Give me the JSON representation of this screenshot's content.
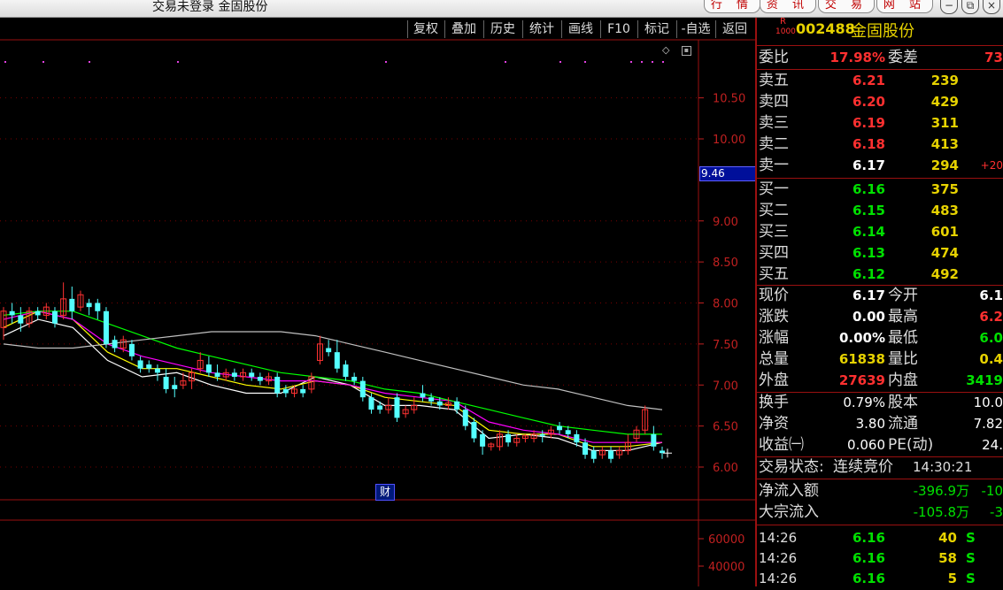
{
  "window": {
    "title": "交易未登录  金固股份",
    "buttons": [
      "行 情",
      "资 讯",
      "交 易",
      "网 站"
    ],
    "controls": [
      "−",
      "⧉",
      "×"
    ]
  },
  "toolbar": {
    "items": [
      "复权",
      "叠加",
      "历史",
      "统计",
      "画线",
      "F10",
      "标记",
      "-自选",
      "返回"
    ]
  },
  "chart": {
    "price_marker": "9.46",
    "badge": "财",
    "price_axis_labels": [
      "10.50",
      "10.00",
      "9.00",
      "8.50",
      "8.00",
      "7.50",
      "7.00",
      "6.50",
      "6.00"
    ],
    "volume_axis_labels": [
      "60000",
      "40000"
    ],
    "colors": {
      "up": "#ff3232",
      "down": "#54ffff",
      "ma1": "#ffffff",
      "ma2": "#ffff00",
      "ma3": "#ff00ff",
      "ma4": "#00ff00",
      "ma5": "#c0c0c0"
    }
  },
  "chart_data": {
    "type": "candlestick",
    "ylim": [
      5.9,
      10.9
    ],
    "candles": [
      [
        7.7,
        7.9,
        7.55,
        7.95
      ],
      [
        7.9,
        7.85,
        7.75,
        8.0
      ],
      [
        7.85,
        7.75,
        7.65,
        7.95
      ],
      [
        7.75,
        7.9,
        7.7,
        7.95
      ],
      [
        7.9,
        7.85,
        7.8,
        7.95
      ],
      [
        7.85,
        7.95,
        7.8,
        8.0
      ],
      [
        7.9,
        7.75,
        7.7,
        7.95
      ],
      [
        7.85,
        8.05,
        7.8,
        8.25
      ],
      [
        8.05,
        7.9,
        7.8,
        8.2
      ],
      [
        7.95,
        8.1,
        7.9,
        8.15
      ],
      [
        8.0,
        7.95,
        7.85,
        8.05
      ],
      [
        8.0,
        7.9,
        7.8,
        8.05
      ],
      [
        7.9,
        7.5,
        7.45,
        7.95
      ],
      [
        7.55,
        7.45,
        7.4,
        7.6
      ],
      [
        7.45,
        7.55,
        7.4,
        7.6
      ],
      [
        7.5,
        7.35,
        7.3,
        7.55
      ],
      [
        7.3,
        7.2,
        7.15,
        7.35
      ],
      [
        7.25,
        7.2,
        7.15,
        7.3
      ],
      [
        7.2,
        7.15,
        7.05,
        7.25
      ],
      [
        7.1,
        6.95,
        6.9,
        7.2
      ],
      [
        7.0,
        6.95,
        6.85,
        7.1
      ],
      [
        7.0,
        7.05,
        6.95,
        7.15
      ],
      [
        7.05,
        7.15,
        6.95,
        7.2
      ],
      [
        7.2,
        7.3,
        7.15,
        7.4
      ],
      [
        7.25,
        7.15,
        7.1,
        7.35
      ],
      [
        7.15,
        7.1,
        7.05,
        7.25
      ],
      [
        7.1,
        7.15,
        7.05,
        7.2
      ],
      [
        7.15,
        7.1,
        7.05,
        7.2
      ],
      [
        7.1,
        7.15,
        7.05,
        7.2
      ],
      [
        7.15,
        7.1,
        7.05,
        7.2
      ],
      [
        7.1,
        7.05,
        7.0,
        7.15
      ],
      [
        7.05,
        7.1,
        7.0,
        7.15
      ],
      [
        7.1,
        6.9,
        6.85,
        7.15
      ],
      [
        6.95,
        6.9,
        6.85,
        7.0
      ],
      [
        6.9,
        6.95,
        6.85,
        7.0
      ],
      [
        6.95,
        6.9,
        6.85,
        7.0
      ],
      [
        6.95,
        7.1,
        6.9,
        7.15
      ],
      [
        7.3,
        7.5,
        7.25,
        7.6
      ],
      [
        7.45,
        7.4,
        7.35,
        7.55
      ],
      [
        7.4,
        7.2,
        7.15,
        7.55
      ],
      [
        7.25,
        7.1,
        7.05,
        7.3
      ],
      [
        7.1,
        7.05,
        7.0,
        7.15
      ],
      [
        7.05,
        6.85,
        6.8,
        7.1
      ],
      [
        6.85,
        6.7,
        6.65,
        6.9
      ],
      [
        6.75,
        6.7,
        6.65,
        6.8
      ],
      [
        6.7,
        6.75,
        6.65,
        6.85
      ],
      [
        6.85,
        6.6,
        6.55,
        6.9
      ],
      [
        6.65,
        6.7,
        6.6,
        6.75
      ],
      [
        6.7,
        6.75,
        6.65,
        6.85
      ],
      [
        6.9,
        6.85,
        6.8,
        7.0
      ],
      [
        6.85,
        6.8,
        6.75,
        6.9
      ],
      [
        6.8,
        6.75,
        6.7,
        6.85
      ],
      [
        6.75,
        6.78,
        6.7,
        6.85
      ],
      [
        6.8,
        6.7,
        6.65,
        6.85
      ],
      [
        6.7,
        6.5,
        6.45,
        6.75
      ],
      [
        6.55,
        6.35,
        6.3,
        6.6
      ],
      [
        6.4,
        6.25,
        6.15,
        6.45
      ],
      [
        6.25,
        6.28,
        6.2,
        6.3
      ],
      [
        6.25,
        6.4,
        6.2,
        6.45
      ],
      [
        6.4,
        6.3,
        6.25,
        6.45
      ],
      [
        6.3,
        6.35,
        6.25,
        6.4
      ],
      [
        6.35,
        6.38,
        6.3,
        6.4
      ],
      [
        6.35,
        6.4,
        6.3,
        6.45
      ],
      [
        6.4,
        6.38,
        6.3,
        6.45
      ],
      [
        6.4,
        6.45,
        6.35,
        6.5
      ],
      [
        6.5,
        6.45,
        6.4,
        6.55
      ],
      [
        6.45,
        6.4,
        6.35,
        6.5
      ],
      [
        6.4,
        6.3,
        6.25,
        6.45
      ],
      [
        6.3,
        6.15,
        6.1,
        6.35
      ],
      [
        6.2,
        6.1,
        6.05,
        6.25
      ],
      [
        6.15,
        6.2,
        6.1,
        6.25
      ],
      [
        6.2,
        6.1,
        6.05,
        6.25
      ],
      [
        6.15,
        6.2,
        6.1,
        6.25
      ],
      [
        6.2,
        6.3,
        6.15,
        6.4
      ],
      [
        6.35,
        6.45,
        6.3,
        6.5
      ],
      [
        6.45,
        6.7,
        6.4,
        6.75
      ],
      [
        6.4,
        6.25,
        6.2,
        6.5
      ],
      [
        6.2,
        6.17,
        6.1,
        6.25
      ]
    ],
    "ma": [
      {
        "color": "#ffffff",
        "points": [
          7.6,
          7.8,
          7.7,
          7.3,
          7.1,
          7.15,
          7.0,
          6.9,
          6.9,
          7.1,
          7.0,
          6.75,
          6.75,
          6.7,
          6.35,
          6.4,
          6.35,
          6.2,
          6.2,
          6.3
        ]
      },
      {
        "color": "#ffff00",
        "points": [
          7.7,
          7.9,
          7.8,
          7.4,
          7.2,
          7.2,
          7.1,
          7.0,
          6.95,
          7.05,
          7.0,
          6.85,
          6.8,
          6.75,
          6.45,
          6.4,
          6.4,
          6.25,
          6.25,
          6.3
        ]
      },
      {
        "color": "#ff00ff",
        "points": [
          7.8,
          7.9,
          7.8,
          7.5,
          7.35,
          7.25,
          7.15,
          7.1,
          7.05,
          7.05,
          7.0,
          6.9,
          6.85,
          6.8,
          6.55,
          6.45,
          6.4,
          6.3,
          6.3,
          6.3
        ]
      },
      {
        "color": "#00ff00",
        "points": [
          7.85,
          7.9,
          7.9,
          7.75,
          7.6,
          7.45,
          7.35,
          7.25,
          7.15,
          7.1,
          7.05,
          6.95,
          6.9,
          6.8,
          6.7,
          6.6,
          6.5,
          6.45,
          6.4,
          6.4
        ]
      },
      {
        "color": "#c0c0c0",
        "points": [
          7.5,
          7.45,
          7.45,
          7.5,
          7.55,
          7.6,
          7.65,
          7.65,
          7.65,
          7.6,
          7.5,
          7.4,
          7.3,
          7.2,
          7.1,
          7.0,
          6.95,
          6.85,
          6.75,
          6.7
        ]
      }
    ]
  },
  "quote": {
    "code": "002488",
    "name": "金固股份",
    "r_badge": "R",
    "r_sub": "1000",
    "weibi": {
      "label": "委比",
      "value": "17.98%",
      "label2": "委差",
      "value2": "73"
    },
    "asks": [
      {
        "label": "卖五",
        "price": "6.21",
        "vol": "239",
        "chg": ""
      },
      {
        "label": "卖四",
        "price": "6.20",
        "vol": "429",
        "chg": ""
      },
      {
        "label": "卖三",
        "price": "6.19",
        "vol": "311",
        "chg": ""
      },
      {
        "label": "卖二",
        "price": "6.18",
        "vol": "413",
        "chg": ""
      },
      {
        "label": "卖一",
        "price": "6.17",
        "vol": "294",
        "chg": "+20"
      }
    ],
    "bids": [
      {
        "label": "买一",
        "price": "6.16",
        "vol": "375"
      },
      {
        "label": "买二",
        "price": "6.15",
        "vol": "483"
      },
      {
        "label": "买三",
        "price": "6.14",
        "vol": "601"
      },
      {
        "label": "买四",
        "price": "6.13",
        "vol": "474"
      },
      {
        "label": "买五",
        "price": "6.12",
        "vol": "492"
      }
    ],
    "stats": [
      {
        "l1": "现价",
        "v1": "6.17",
        "l2": "今开",
        "v2": "6.1"
      },
      {
        "l1": "涨跌",
        "v1": "0.00",
        "l2": "最高",
        "v2": "6.2"
      },
      {
        "l1": "涨幅",
        "v1": "0.00%",
        "l2": "最低",
        "v2": "6.0"
      },
      {
        "l1": "总量",
        "v1": "61838",
        "l2": "量比",
        "v2": "0.4"
      },
      {
        "l1": "外盘",
        "v1": "27639",
        "l2": "内盘",
        "v2": "3419"
      }
    ],
    "stats2": [
      {
        "l1": "换手",
        "v1": "0.79%",
        "l2": "股本",
        "v2": "10.0"
      },
      {
        "l1": "净资",
        "v1": "3.80",
        "l2": "流通",
        "v2": "7.82"
      },
      {
        "l1": "收益㈠",
        "v1": "0.060",
        "l2": "PE(动)",
        "v2": "24."
      }
    ],
    "status": {
      "label": "交易状态:",
      "value": "连续竞价",
      "time": "14:30:21"
    },
    "flows": [
      {
        "label": "净流入额",
        "v1": "-396.9万",
        "v2": "-10"
      },
      {
        "label": "大宗流入",
        "v1": "-105.8万",
        "v2": "-3"
      }
    ],
    "ticks": [
      {
        "time": "14:26",
        "price": "6.16",
        "vol": "40",
        "side": "S"
      },
      {
        "time": "14:26",
        "price": "6.16",
        "vol": "58",
        "side": "S"
      },
      {
        "time": "14:26",
        "price": "6.16",
        "vol": "5",
        "side": "S"
      }
    ]
  }
}
